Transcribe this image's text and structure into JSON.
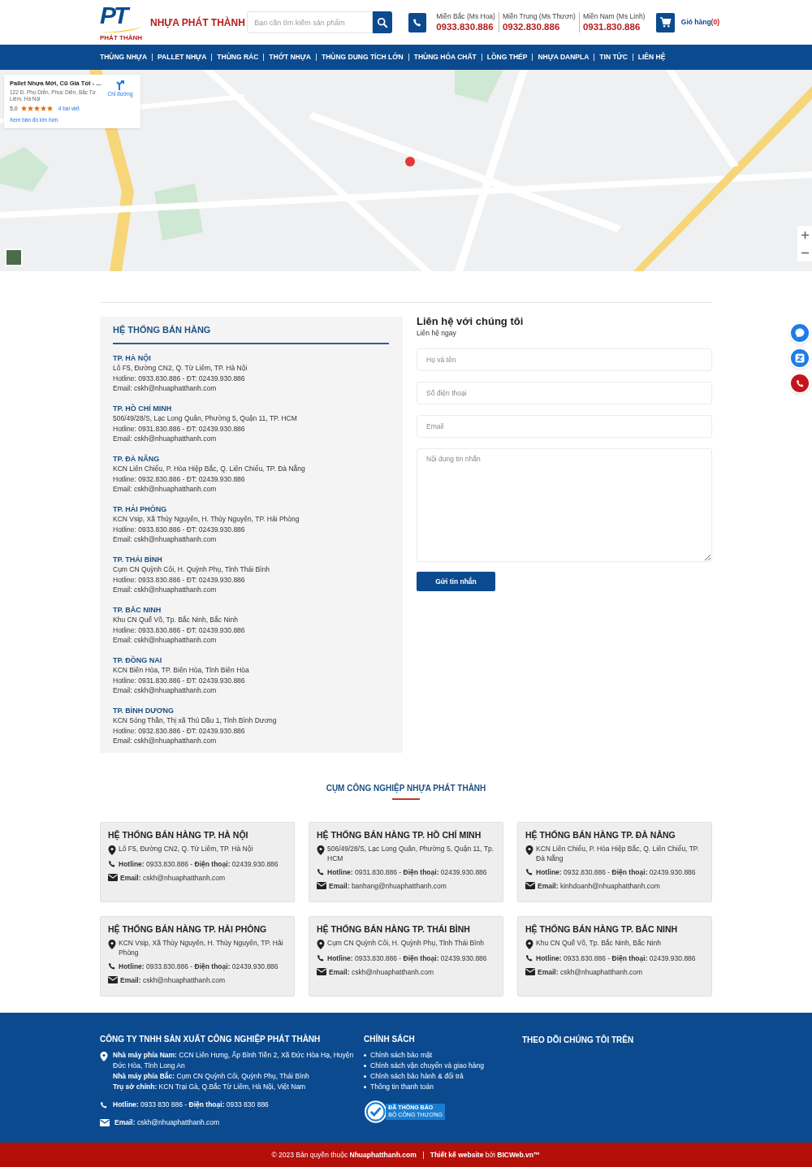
{
  "header": {
    "brand": "NHỰA PHÁT THÀNH",
    "logo_caption": "PHÁT THÀNH",
    "logo_letters": "PT",
    "search": {
      "placeholder": "Bạn cần tìm kiếm sản phẩm"
    },
    "hotlines": [
      {
        "region": "Miền Bắc (Ms Hoa)",
        "phone": "0933.830.886"
      },
      {
        "region": "Miền Trung (Ms Thươn)",
        "phone": "0932.830.886"
      },
      {
        "region": "Miền Nam (Ms Linh)",
        "phone": "0931.830.886"
      }
    ],
    "cart": {
      "label": "Giỏ hàng",
      "count": "(0)"
    }
  },
  "nav": [
    "THÙNG NHỰA",
    "PALLET NHỰA",
    "THÙNG RÁC",
    "THỚT NHỰA",
    "THÙNG DUNG TÍCH LỚN",
    "THÙNG HÓA CHẤT",
    "LỒNG THÉP",
    "NHỰA DANPLA",
    "TIN TỨC",
    "LIÊN HỆ"
  ],
  "map": {
    "kind": "picture",
    "place_card": {
      "title": "Pallet Nhựa Mới, Cũ Giá Tốt - ...",
      "address": "122 Đ. Phú Diễn, Phúc Diễn, Bắc Từ Liêm, Hà Nội",
      "rating": "5,0",
      "stars": 5,
      "reviews": "4 bài viết",
      "larger_map": "Xem bản đồ lớn hơn",
      "directions": "Chỉ đường"
    }
  },
  "sales_system": {
    "title": "HỆ THỐNG BÁN HÀNG",
    "branches": [
      {
        "city": "TP. HÀ NỘI",
        "address": "Lô F5, Đường CN2, Q. Từ Liêm, TP. Hà Nội",
        "phones": "Hotline: 0933.830.886 - ĐT: 02439.930.886",
        "email": "Email: cskh@nhuaphatthanh.com"
      },
      {
        "city": "TP. HỒ CHÍ MINH",
        "address": "506/49/28/S, Lạc Long Quân, Phường 5, Quận 11, TP. HCM",
        "phones": "Hotline: 0931.830.886 - ĐT: 02439.930.886",
        "email": "Email: cskh@nhuaphatthanh.com"
      },
      {
        "city": "TP. ĐÀ NẴNG",
        "address": "KCN Liên Chiểu, P. Hòa Hiệp Bắc, Q. Liên Chiểu, TP. Đà Nẵng",
        "phones": "Hotline: 0932.830.886 - ĐT: 02439.930.886",
        "email": "Email: cskh@nhuaphatthanh.com"
      },
      {
        "city": "TP. HẢI PHÒNG",
        "address": "KCN Vsip, Xã Thủy Nguyên, H. Thủy Nguyên, TP. Hải Phòng",
        "phones": "Hotline: 0933.830.886 - ĐT: 02439.930.886",
        "email": "Email: cskh@nhuaphatthanh.com"
      },
      {
        "city": "TP. THÁI BÌNH",
        "address": "Cụm CN Quỳnh Côi, H. Quỳnh Phụ, Tỉnh Thái Bình",
        "phones": "Hotline: 0933.830.886 - ĐT: 02439.930.886",
        "email": "Email: cskh@nhuaphatthanh.com"
      },
      {
        "city": "TP. BẮC NINH",
        "address": "Khu CN Quế Võ, Tp. Bắc Ninh, Bắc Ninh",
        "phones": "Hotline: 0933.830.886 - ĐT: 02439.930.886",
        "email": "Email: cskh@nhuaphatthanh.com"
      },
      {
        "city": "TP. ĐỒNG NAI",
        "address": "KCN Biên Hòa, TP. Biên Hòa, Tỉnh Biên Hòa",
        "phones": "Hotline: 0931.830.886 - ĐT: 02439.930.886",
        "email": "Email: cskh@nhuaphatthanh.com"
      },
      {
        "city": "TP. BÌNH DƯƠNG",
        "address": "KCN Sóng Thần, Thị xã Thủ Dầu 1, Tỉnh Bình Dương",
        "phones": "Hotline: 0932.830.886 - ĐT: 02439.930.886",
        "email": "Email: cskh@nhuaphatthanh.com"
      }
    ]
  },
  "contact_form": {
    "title": "Liên hệ với chúng tôi",
    "subtitle": "Liên hệ ngay",
    "fields": [
      {
        "kind": "input",
        "placeholder": "Họ và tên"
      },
      {
        "kind": "input",
        "placeholder": "Số điện thoại"
      },
      {
        "kind": "input",
        "placeholder": "Email"
      },
      {
        "kind": "textarea",
        "placeholder": "Nội dung tin nhắn"
      }
    ],
    "submit": "Gửi tin nhắn"
  },
  "cluster": {
    "title": "CỤM CÔNG NGHIỆP NHỰA PHÁT THÀNH",
    "cards": [
      {
        "title": "HỆ THỐNG BÁN HÀNG TP. HÀ NỘI",
        "address": "Lô F5, Đường CN2, Q. Từ Liêm, TP. Hà Nội",
        "phones": "**Hotline:** 0933.830.886 - **Điện thoại:** 02439.930.886",
        "email": "**Email:** cskh@nhuaphatthanh.com"
      },
      {
        "title": "HỆ THỐNG BÁN HÀNG TP. HỒ CHÍ MINH",
        "address": "506/49/28/S, Lạc Long Quân, Phường 5, Quận 11, Tp. HCM",
        "phones": "**Hotline:** 0931.830.886 - **Điện thoại:** 02439.930.886",
        "email": "**Email:** banhang@nhuaphatthanh.com"
      },
      {
        "title": "HỆ THỐNG BÁN HÀNG TP. ĐÀ NẴNG",
        "address": "KCN Liên Chiểu, P. Hòa Hiệp Bắc, Q. Liên Chiểu, TP. Đà Nẵng",
        "phones": "**Hotline:** 0932.830.886 - **Điện thoại:** 02439.930.886",
        "email": "**Email:** kinhdoanh@nhuaphatthanh.com"
      },
      {
        "title": "HỆ THỐNG BÁN HÀNG TP. HẢI PHÒNG",
        "address": "KCN Vsip, Xã Thủy Nguyên, H. Thủy Nguyên, TP. Hải Phòng",
        "phones": "**Hotline:** 0933.830.886 - **Điện thoại:** 02439.930.886",
        "email": "**Email:** cskh@nhuaphatthanh.com"
      },
      {
        "title": "HỆ THỐNG BÁN HÀNG TP. THÁI BÌNH",
        "address": "Cụm CN Quỳnh Côi, H. Quỳnh Phụ, Tỉnh Thái Bình",
        "phones": "**Hotline:** 0933.830.886 - **Điện thoại:** 02439.930.886",
        "email": "**Email:** cskh@nhuaphatthanh.com"
      },
      {
        "title": "HỆ THỐNG BÁN HÀNG TP. BẮC NINH",
        "address": "Khu CN Quế Võ, Tp. Bắc Ninh, Bắc Ninh",
        "phones": "**Hotline:** 0933.830.886 - **Điện thoại:** 02439.930.886",
        "email": "**Email:** cskh@nhuaphatthanh.com"
      }
    ]
  },
  "footer": {
    "company": "CÔNG TY TNHH SẢN XUẤT CÔNG NGHIỆP PHÁT THÀNH",
    "addresses": [
      "**Nhà máy phía Nam:** CCN Liên Hưng, Ấp Bình Tiền 2, Xã Đức Hòa Hạ, Huyện Đức Hòa, Tỉnh Long An",
      "**Nhà máy phía Bắc:** Cụm CN Quỳnh Côi, Quỳnh Phụ, Thái Bình",
      "**Trụ sở chính:** KCN Trại Gà, Q.Bắc Từ Liêm, Hà Nội, Việt Nam"
    ],
    "phones": "**Hotline:** 0933 830 886 - **Điện thoại:** 0933 830 886",
    "email": "**Email:** cskh@nhuaphatthanh.com",
    "policy_title": "CHÍNH SÁCH",
    "policies": [
      "Chính sách bảo mật",
      "Chính sách vận chuyển và giao hàng",
      "Chính sách bảo hành & đổi trả",
      "Thông tin thanh toán"
    ],
    "badge": {
      "line1": "ĐÃ THÔNG BÁO",
      "line2": "BỘ CÔNG THƯƠNG"
    },
    "follow_title": "THEO DÕI CHÚNG TÔI TRÊN",
    "copyright": "© 2023 Bản quyền thuộc **Nhuaphatthanh.com**",
    "credit": "**Thiết kế website** bởi **BICWeb.vn™**"
  }
}
